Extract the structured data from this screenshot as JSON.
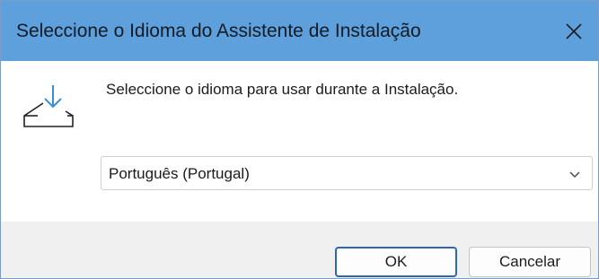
{
  "window": {
    "title": "Seleccione o Idioma do Assistente de Instalação",
    "close_icon": "close-icon"
  },
  "content": {
    "icon": "setup-download-icon",
    "prompt": "Seleccione o idioma para usar durante a Instalação."
  },
  "language_select": {
    "value": "Português (Portugal)",
    "icon": "chevron-down-icon"
  },
  "buttons": {
    "ok_label": "OK",
    "cancel_label": "Cancelar"
  },
  "colors": {
    "titlebar": "#5ea0dc",
    "default_button_border": "#2b67b5",
    "footer": "#f0f0f0"
  }
}
